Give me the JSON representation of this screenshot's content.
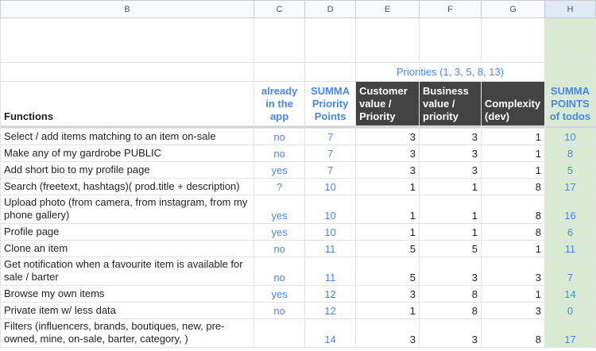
{
  "columns": [
    "B",
    "C",
    "D",
    "E",
    "F",
    "G",
    "H"
  ],
  "header": {
    "priorities_label": "Priorities (1, 3, 5, 8, 13)",
    "functions": "Functions",
    "already": "already in the app",
    "summa_priority": "SUMMA Priority Points",
    "customer": "Customer value / Priority",
    "business": "Business value / priority",
    "complexity": "Complexity (dev)",
    "summa_todos": "SUMMA POINTS of todos"
  },
  "rows": [
    {
      "fn": "Select / add items matching to an item on-sale",
      "already": "no",
      "summa": "7",
      "cust": "3",
      "bus": "3",
      "cx": "1",
      "todo": "10"
    },
    {
      "fn": "Make any of my gardrobe PUBLIC",
      "already": "no",
      "summa": "7",
      "cust": "3",
      "bus": "3",
      "cx": "1",
      "todo": "8"
    },
    {
      "fn": "Add short bio to my profile page",
      "already": "yes",
      "summa": "7",
      "cust": "3",
      "bus": "3",
      "cx": "1",
      "todo": "5"
    },
    {
      "fn": "Search (freetext, hashtags)( prod.title + description)",
      "already": "?",
      "summa": "10",
      "cust": "1",
      "bus": "1",
      "cx": "8",
      "todo": "17"
    },
    {
      "fn": "Upload photo (from camera, from instagram, from my phone gallery)",
      "already": "yes",
      "summa": "10",
      "cust": "1",
      "bus": "1",
      "cx": "8",
      "todo": "16"
    },
    {
      "fn": "Profile page",
      "already": "yes",
      "summa": "10",
      "cust": "1",
      "bus": "1",
      "cx": "8",
      "todo": "6"
    },
    {
      "fn": "Clone an item",
      "already": "no",
      "summa": "11",
      "cust": "5",
      "bus": "5",
      "cx": "1",
      "todo": "11"
    },
    {
      "fn": "Get notification when a favourite item is available for sale / barter",
      "already": "no",
      "summa": "11",
      "cust": "5",
      "bus": "3",
      "cx": "3",
      "todo": "7"
    },
    {
      "fn": "Browse my own items",
      "already": "yes",
      "summa": "12",
      "cust": "3",
      "bus": "8",
      "cx": "1",
      "todo": "14"
    },
    {
      "fn": "Private item w/ less data",
      "already": "no",
      "summa": "12",
      "cust": "1",
      "bus": "8",
      "cx": "3",
      "todo": "0"
    },
    {
      "fn": "Filters (influencers, brands, boutiques, new, pre-owned, mine, on-sale, barter, category, )",
      "already": "",
      "summa": "14",
      "cust": "3",
      "bus": "3",
      "cx": "8",
      "todo": "17"
    }
  ]
}
